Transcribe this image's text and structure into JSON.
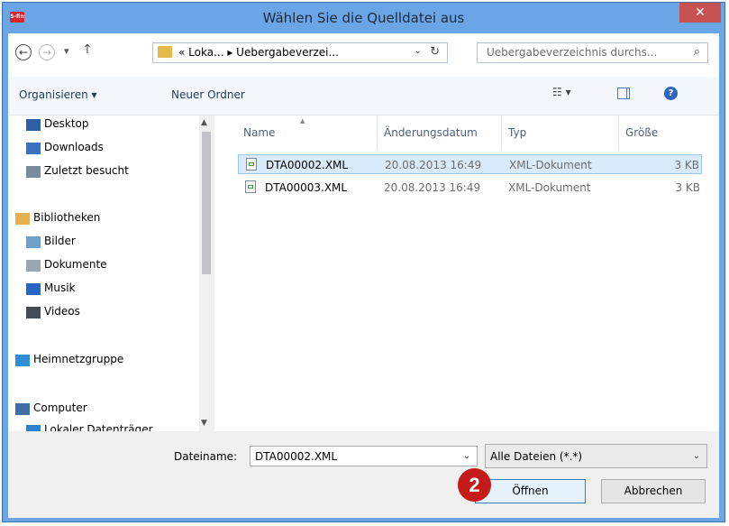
{
  "window": {
    "title": "Wählen Sie die Quelldatei aus",
    "close_glyph": "✕",
    "app_icon_text": "S-fin"
  },
  "nav": {
    "back": "←",
    "forward": "→",
    "recent": "▾",
    "up": "↑"
  },
  "address": {
    "path": "« Loka... ▸ Uebergabeverzei...",
    "dropdown": "⌄",
    "refresh": "↻"
  },
  "search": {
    "placeholder": "Uebergabeverzeichnis durchs...",
    "icon": "⌕"
  },
  "toolbar": {
    "organize": "Organisieren ▾",
    "new_folder": "Neuer Ordner",
    "view_icon": "☷ ▾",
    "help": "?"
  },
  "sidebar": {
    "items": [
      {
        "label": "Desktop",
        "icon": "desktop-icon",
        "color": "#2c5fa3"
      },
      {
        "label": "Downloads",
        "icon": "downloads-icon",
        "color": "#3b6fbf"
      },
      {
        "label": "Zuletzt besucht",
        "icon": "recent-places-icon",
        "color": "#7a8b9c"
      },
      {
        "label": "Bibliotheken",
        "icon": "libraries-icon",
        "color": "#e3b04b"
      },
      {
        "label": "Bilder",
        "icon": "pictures-icon",
        "color": "#6f9fcb"
      },
      {
        "label": "Dokumente",
        "icon": "documents-icon",
        "color": "#9aa7b3"
      },
      {
        "label": "Musik",
        "icon": "music-icon",
        "color": "#2a63c6"
      },
      {
        "label": "Videos",
        "icon": "videos-icon",
        "color": "#444c55"
      },
      {
        "label": "Heimnetzgruppe",
        "icon": "homegroup-icon",
        "color": "#2f8fd4"
      },
      {
        "label": "Computer",
        "icon": "computer-icon",
        "color": "#3d6fa6"
      },
      {
        "label": "Lokaler Datenträger",
        "icon": "drive-icon",
        "color": "#2b80d1"
      }
    ]
  },
  "columns": {
    "name": "Name",
    "date": "Änderungsdatum",
    "type": "Typ",
    "size": "Größe"
  },
  "files": [
    {
      "name": "DTA00002.XML",
      "date": "20.08.2013 16:49",
      "type": "XML-Dokument",
      "size": "3 KB",
      "selected": true
    },
    {
      "name": "DTA00003.XML",
      "date": "20.08.2013 16:49",
      "type": "XML-Dokument",
      "size": "3 KB",
      "selected": false
    }
  ],
  "footer": {
    "filename_label": "Dateiname:",
    "filename_value": "DTA00002.XML",
    "filter_value": "Alle Dateien (*.*)",
    "open": "Öffnen",
    "cancel": "Abbrechen",
    "dropdown": "⌄"
  },
  "annotation": {
    "step": "2"
  },
  "colors": {
    "titlebar": "#6aa5e6",
    "close": "#c75050",
    "selection": "#d9ebfb",
    "badge": "#c41a1a"
  }
}
